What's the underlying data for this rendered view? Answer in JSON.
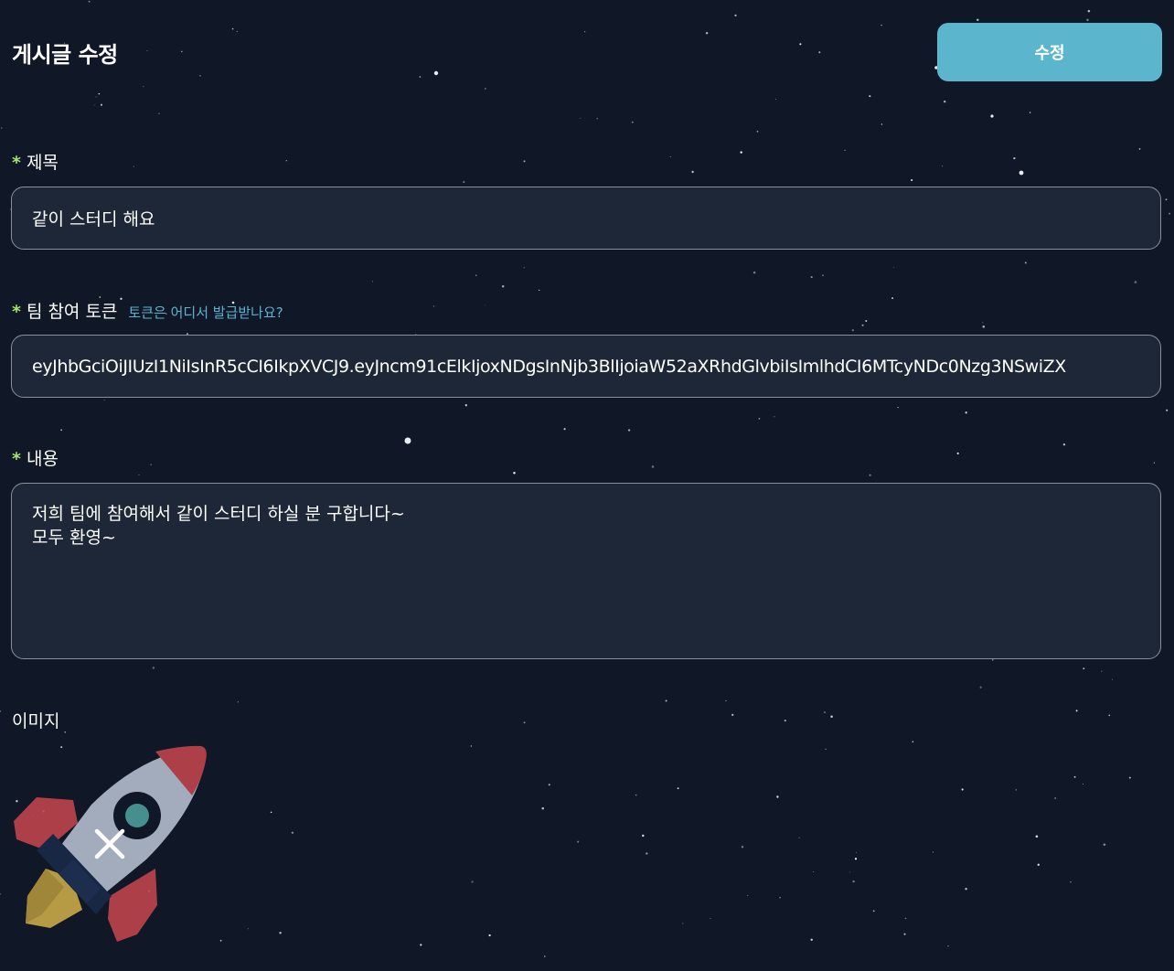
{
  "header": {
    "title": "게시글 수정",
    "submit_label": "수정"
  },
  "form": {
    "required_mark": "*",
    "title_field": {
      "label": "제목",
      "value": "같이 스터디 해요"
    },
    "token_field": {
      "label": "팀 참여 토큰",
      "help_link": "토큰은 어디서 발급받나요?",
      "value": "eyJhbGciOiJIUzI1NiIsInR5cCI6IkpXVCJ9.eyJncm91cElkIjoxNDgsInNjb3BlIjoiaW52aXRhdGlvbiIsImlhdCI6MTcyNDc0Nzg3NSwiZX"
    },
    "content_field": {
      "label": "내용",
      "value": "저희 팀에 참여해서 같이 스터디 하실 분 구합니다~\n모두 환영~"
    },
    "image_field": {
      "label": "이미지",
      "image_icon": "rocket-icon",
      "remove_icon": "close-icon"
    }
  },
  "colors": {
    "background": "#101727",
    "accent": "#5ab5cd",
    "required": "#a6e36b",
    "input_bg": "#1e2737"
  }
}
